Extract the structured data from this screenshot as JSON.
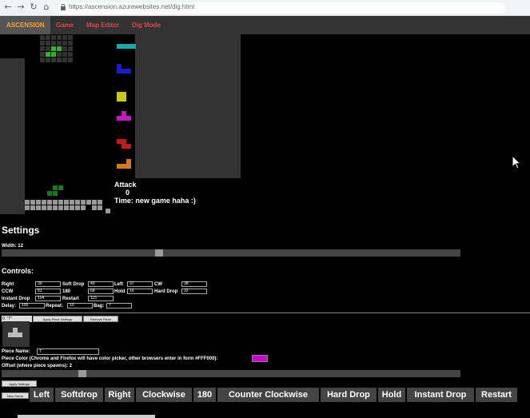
{
  "browser": {
    "url": "https://ascension.azurewebsites.net/dig.html"
  },
  "nav": {
    "brand": "ASCENSION",
    "links": [
      "Game",
      "Map Editor",
      "Dig Mode"
    ]
  },
  "game": {
    "attack_label": "Attack",
    "attack_value": "0",
    "time_text": "Time: new game haha :)"
  },
  "colors": {
    "green": "#2db52d",
    "cyan": "#1aaaaa",
    "blue": "#1a1ad0",
    "yellow": "#c8c81a",
    "magenta": "#c01ac0",
    "red": "#c01a1a",
    "orange": "#d07a1a",
    "dark_green": "#1a7a1a"
  },
  "settings": {
    "title": "Settings",
    "width_label": "Width: 12",
    "width_slider_fraction": 0.34
  },
  "controls": {
    "title": "Controls:",
    "fields": [
      {
        "label": "Right",
        "value": "39"
      },
      {
        "label": "Soft Drop",
        "value": "40"
      },
      {
        "label": "Left",
        "value": "37"
      },
      {
        "label": "CW",
        "value": "38"
      },
      {
        "label": "CCW",
        "value": "83"
      },
      {
        "label": "180",
        "value": "68"
      },
      {
        "label": "Hold",
        "value": "16"
      },
      {
        "label": "Hard Drop",
        "value": "32"
      },
      {
        "label": "Instant Drop",
        "value": "104"
      },
      {
        "label": "Restart",
        "value": "115"
      },
      {
        "label": "Delay:",
        "value": "100"
      },
      {
        "label": "Repeat:",
        "value": "10"
      },
      {
        "label": "Bag:",
        "value": "7"
      }
    ]
  },
  "piece_editor": {
    "selected_piece": "0. \"T\"",
    "apply_piece_button": "Apply Piece Settings",
    "remove_piece_button": "Remove Piece",
    "piece_name_label": "Piece Name:",
    "piece_name_value": "T",
    "color_label": "Piece Color (Chrome and Firefox will have color picker, other browsers enter in form #FFF000):",
    "color_value": "#cc00cc",
    "offset_label": "Offset (where piece spawns): 2",
    "offset_slider_fraction": 0.17,
    "apply_settings_button": "Apply Settings"
  },
  "keybinds": {
    "new_game_button": "New Game",
    "keys": [
      "Left",
      "Softdrop",
      "Right",
      "Clockwise",
      "180",
      "Counter Clockwise",
      "Hard Drop",
      "Hold",
      "Instant Drop",
      "Restart"
    ]
  }
}
